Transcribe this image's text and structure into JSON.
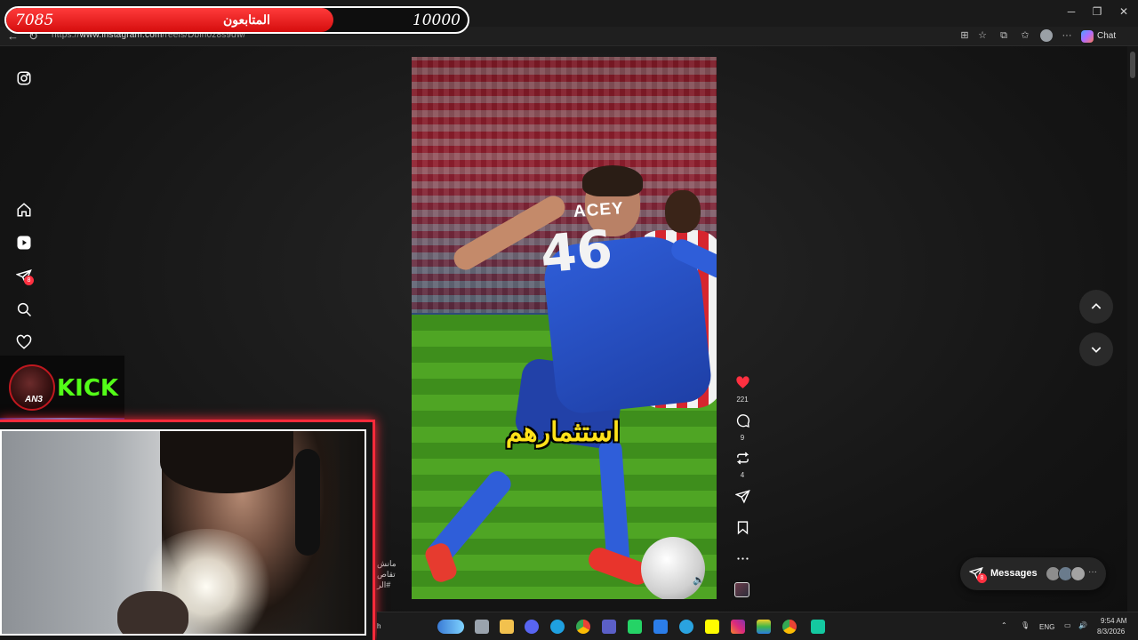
{
  "browser": {
    "url_prefix": "https://",
    "url_host": "www.instagram.com",
    "url_path": "/reels/Dbln0z8s9dw/",
    "chat_label": "Chat"
  },
  "followers_widget": {
    "current": "7085",
    "label": "المتابعون",
    "goal": "10000",
    "progress_fraction": 0.7085,
    "fill_color": "#e01b1b"
  },
  "sidebar": {
    "items": [
      {
        "name": "instagram-logo-icon"
      },
      {
        "name": "home-icon"
      },
      {
        "name": "reels-icon"
      },
      {
        "name": "messages-icon",
        "badge": "8"
      },
      {
        "name": "search-icon"
      },
      {
        "name": "notifications-heart-icon"
      }
    ]
  },
  "reel": {
    "jersey_name": "ACEY",
    "jersey_number": "46",
    "caption": "استثمارهم"
  },
  "actions": {
    "likes": "221",
    "comments": "9",
    "reposts": "4"
  },
  "messages_pill": {
    "label": "Messages",
    "badge": "8",
    "more": "···"
  },
  "stream_overlay": {
    "kick_label": "KICK",
    "logo_text": "AN3"
  },
  "post_text": {
    "line1": "مانش",
    "line2": "تقاص",
    "line3": "#الر"
  },
  "taskbar": {
    "search_fragment": "h",
    "language": "ENG",
    "time": "9:54 AM",
    "date": "8/3/2026"
  },
  "colors": {
    "accent_red": "#ff3040",
    "kick_green": "#53fc18",
    "webcam_frame": "#ff2a3a"
  }
}
